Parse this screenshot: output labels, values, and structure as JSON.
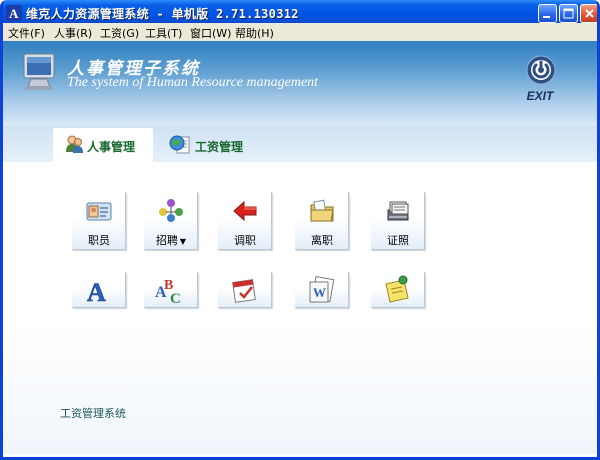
{
  "window": {
    "title": "维克人力资源管理系统 - 单机版 2.71.130312",
    "buttons": [
      "minimize",
      "maximize",
      "close"
    ]
  },
  "menu": [
    {
      "label": "文件(F)"
    },
    {
      "label": "人事(R)"
    },
    {
      "label": "工资(G)"
    },
    {
      "label": "工具(T)"
    },
    {
      "label": "窗口(W)"
    },
    {
      "label": "帮助(H)"
    }
  ],
  "banner": {
    "title": "人事管理子系统",
    "subtitle": "The system of Human Resource management",
    "exit_label": "EXIT"
  },
  "tabs": [
    {
      "label": "人事管理",
      "icon": "users-icon",
      "active": true
    },
    {
      "label": "工资管理",
      "icon": "globe-document-icon",
      "active": false
    }
  ],
  "row1": [
    {
      "label": "职员",
      "icon": "id-card-icon"
    },
    {
      "label": "招聘",
      "icon": "people-recruit-icon",
      "dropdown": true,
      "caret": "▼"
    },
    {
      "label": "调职",
      "icon": "red-arrow-icon"
    },
    {
      "label": "离职",
      "icon": "folder-exit-icon"
    },
    {
      "label": "证照",
      "icon": "certificate-stack-icon"
    }
  ],
  "row2": [
    {
      "icon": "letter-a-icon"
    },
    {
      "icon": "abc-icon"
    },
    {
      "icon": "calendar-icon"
    },
    {
      "icon": "word-document-icon"
    },
    {
      "icon": "sticky-note-icon"
    }
  ],
  "footer": {
    "link": "工资管理系统"
  }
}
